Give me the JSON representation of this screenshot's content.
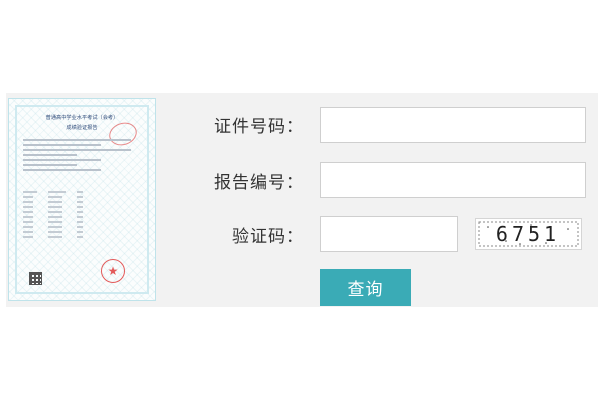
{
  "certificate": {
    "title": "普通高中学业水平考试（会考）",
    "subtitle": "成绩验证报告"
  },
  "form": {
    "id_label": "证件号码：",
    "id_value": "",
    "report_label": "报告编号：",
    "report_value": "",
    "captcha_label": "验证码：",
    "captcha_value": "",
    "captcha_text": "6751",
    "query_button": "查询"
  },
  "colors": {
    "panel_bg": "#f2f2f2",
    "button_bg": "#3aabb6",
    "seal_red": "#e35a5a"
  }
}
